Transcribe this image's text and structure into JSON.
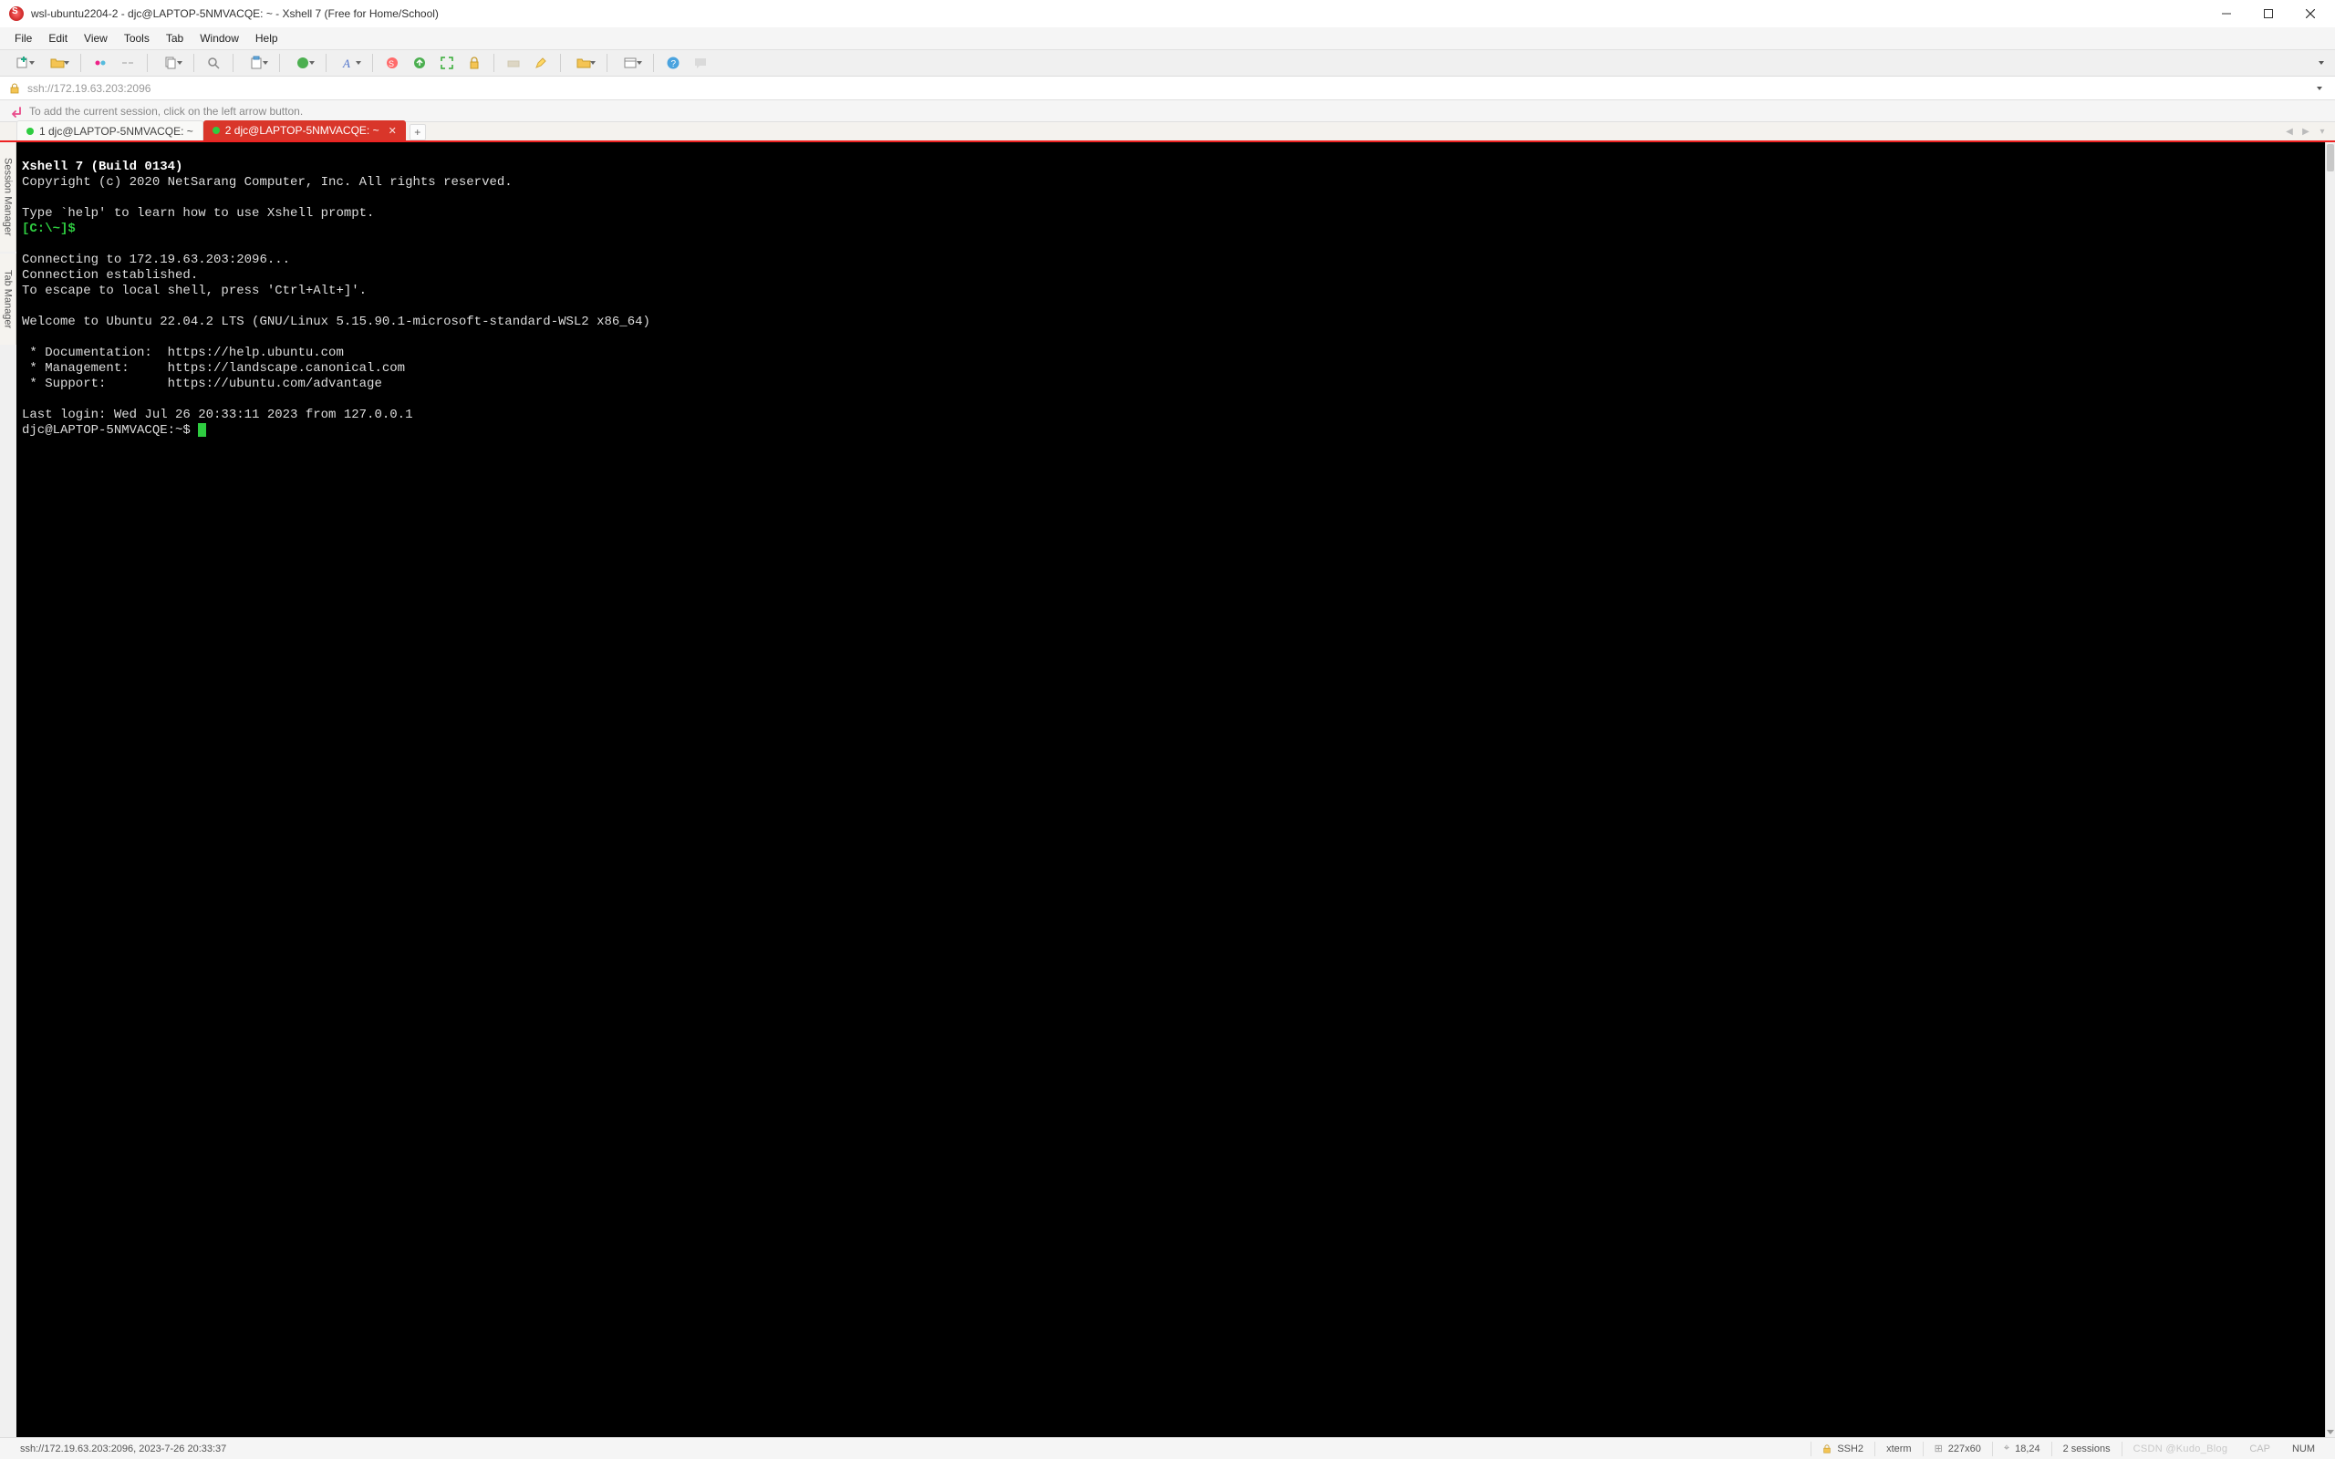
{
  "window": {
    "title": "wsl-ubuntu2204-2 - djc@LAPTOP-5NMVACQE: ~ - Xshell 7 (Free for Home/School)"
  },
  "menu": {
    "file": "File",
    "edit": "Edit",
    "view": "View",
    "tools": "Tools",
    "tab": "Tab",
    "window": "Window",
    "help": "Help"
  },
  "address": {
    "url": "ssh://172.19.63.203:2096"
  },
  "hint": {
    "text": "To add the current session, click on the left arrow button."
  },
  "tabs": {
    "tab1": "1 djc@LAPTOP-5NMVACQE: ~",
    "tab2": "2 djc@LAPTOP-5NMVACQE: ~",
    "add": "+"
  },
  "sidetabs": {
    "t1": "Session Manager",
    "t2": "Tab Manager"
  },
  "terminal": {
    "l1": "Xshell 7 (Build 0134)",
    "l2": "Copyright (c) 2020 NetSarang Computer, Inc. All rights reserved.",
    "l3": "",
    "l4": "Type `help' to learn how to use Xshell prompt.",
    "l5": "[C:\\~]$ ",
    "l6": "",
    "l7": "Connecting to 172.19.63.203:2096...",
    "l8": "Connection established.",
    "l9": "To escape to local shell, press 'Ctrl+Alt+]'.",
    "l10": "",
    "l11": "Welcome to Ubuntu 22.04.2 LTS (GNU/Linux 5.15.90.1-microsoft-standard-WSL2 x86_64)",
    "l12": "",
    "l13": " * Documentation:  https://help.ubuntu.com",
    "l14": " * Management:     https://landscape.canonical.com",
    "l15": " * Support:        https://ubuntu.com/advantage",
    "l16": "",
    "l17": "Last login: Wed Jul 26 20:33:11 2023 from 127.0.0.1",
    "l18": "djc@LAPTOP-5NMVACQE:~$ "
  },
  "status": {
    "left": "ssh://172.19.63.203:2096, 2023-7-26 20:33:37",
    "proto": "SSH2",
    "term": "xterm",
    "size": "227x60",
    "pos": "18,24",
    "sessions": "2 sessions",
    "watermark": "CSDN @Kudo_Blog",
    "caps": "CAP",
    "num": "NUM"
  },
  "colors": {
    "accent_red": "#d9362a",
    "term_green": "#2ecc40"
  }
}
